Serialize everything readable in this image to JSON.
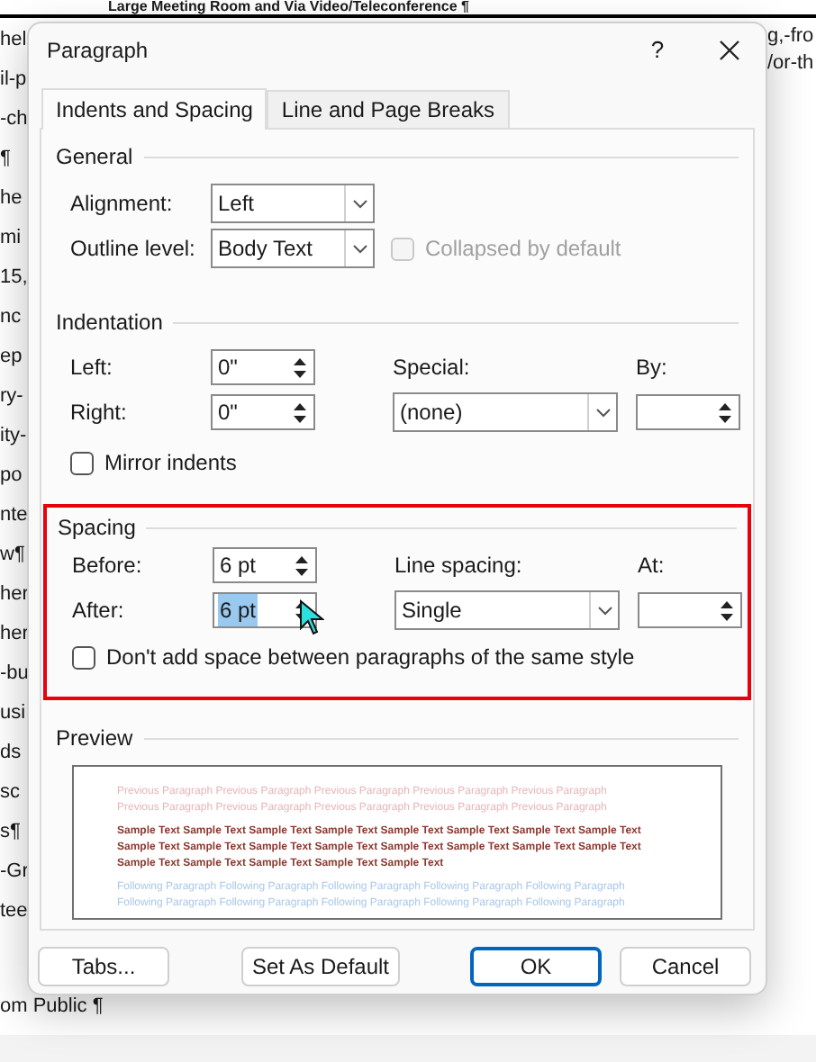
{
  "document": {
    "heading": "Large Meeting Room and Via Video/Teleconference ¶",
    "left_fragments": [
      "hel",
      "il-p",
      "-ch",
      "¶",
      "he",
      "mi",
      "15,",
      "nc",
      "ep",
      "ry-",
      "ity-",
      "po",
      "nte",
      "w¶",
      "her",
      "her",
      "-bu",
      "usi",
      "ds",
      "sc",
      "s¶",
      "-Gr",
      "tee"
    ],
    "below_dialog": "om Public ¶",
    "right_fragments": [
      "g,-fro",
      "/or-th"
    ]
  },
  "dialog": {
    "title": "Paragraph",
    "help": "?",
    "tabs": [
      {
        "label": "Indents and Spacing",
        "selected": true
      },
      {
        "label": "Line and Page Breaks",
        "selected": false
      }
    ],
    "general": {
      "heading": "General",
      "alignment": {
        "label": "Alignment:",
        "value": "Left"
      },
      "outline_level": {
        "label": "Outline level:",
        "value": "Body Text"
      },
      "collapsed": {
        "label": "Collapsed by default",
        "checked": false,
        "disabled": true
      }
    },
    "indentation": {
      "heading": "Indentation",
      "left": {
        "label": "Left:",
        "value": "0\""
      },
      "right": {
        "label": "Right:",
        "value": "0\""
      },
      "special": {
        "label": "Special:",
        "value": "(none)"
      },
      "by": {
        "label": "By:"
      },
      "mirror": {
        "label": "Mirror indents",
        "checked": false
      }
    },
    "spacing": {
      "heading": "Spacing",
      "highlighted": true,
      "before": {
        "label": "Before:",
        "value": "6 pt",
        "text_selected": false
      },
      "after": {
        "label": "After:",
        "value": "6 pt",
        "text_selected": true
      },
      "line_spacing": {
        "label": "Line spacing:",
        "value": "Single"
      },
      "at": {
        "label": "At:"
      },
      "dont_add": {
        "label": "Don't add space between paragraphs of the same style",
        "checked": false
      }
    },
    "preview": {
      "heading": "Preview",
      "previous": [
        "Previous Paragraph Previous Paragraph Previous Paragraph Previous Paragraph Previous Paragraph",
        "Previous Paragraph Previous Paragraph Previous Paragraph Previous Paragraph Previous Paragraph"
      ],
      "sample": [
        "Sample Text Sample Text Sample Text Sample Text Sample Text Sample Text Sample Text Sample Text",
        "Sample Text Sample Text Sample Text Sample Text Sample Text Sample Text Sample Text Sample Text",
        "Sample Text Sample Text Sample Text Sample Text Sample Text"
      ],
      "following": [
        "Following Paragraph Following Paragraph Following Paragraph Following Paragraph Following Paragraph",
        "Following Paragraph Following Paragraph Following Paragraph Following Paragraph Following Paragraph"
      ]
    },
    "buttons": [
      {
        "label": "Tabs...",
        "kind": "normal"
      },
      {
        "label": "Set As Default",
        "kind": "normal"
      },
      {
        "label": "OK",
        "kind": "default"
      },
      {
        "label": "Cancel",
        "kind": "normal"
      }
    ]
  }
}
